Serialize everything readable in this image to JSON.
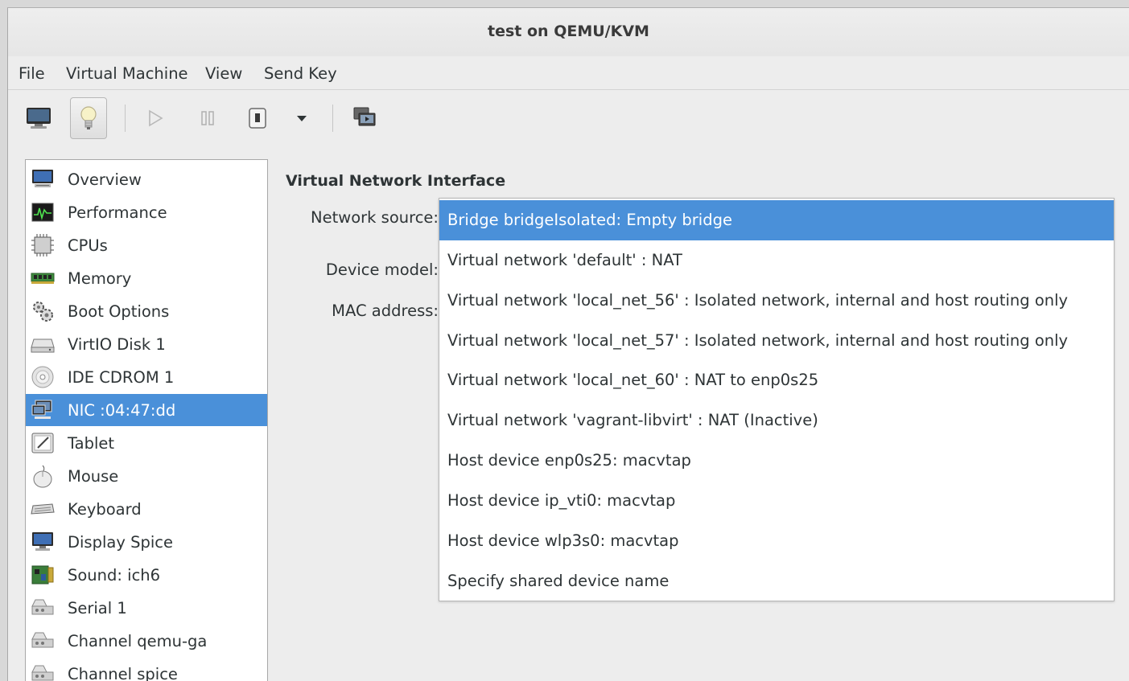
{
  "window": {
    "title": "test on QEMU/KVM"
  },
  "menubar": {
    "items": [
      "File",
      "Virtual Machine",
      "View",
      "Send Key"
    ]
  },
  "toolbar": {
    "buttons": [
      "monitor-icon",
      "lightbulb-icon",
      "play-icon",
      "pause-icon",
      "power-icon",
      "dropdown-arrow-icon",
      "screenshot-icon"
    ],
    "active": "lightbulb-icon"
  },
  "sidebar": {
    "items": [
      {
        "label": "Overview",
        "icon": "monitor-icon"
      },
      {
        "label": "Performance",
        "icon": "performance-graph-icon"
      },
      {
        "label": "CPUs",
        "icon": "cpu-chip-icon"
      },
      {
        "label": "Memory",
        "icon": "memory-module-icon"
      },
      {
        "label": "Boot Options",
        "icon": "gears-icon"
      },
      {
        "label": "VirtIO Disk 1",
        "icon": "hard-disk-icon"
      },
      {
        "label": "IDE CDROM 1",
        "icon": "cdrom-icon"
      },
      {
        "label": "NIC :04:47:dd",
        "icon": "network-card-icon",
        "selected": true
      },
      {
        "label": "Tablet",
        "icon": "tablet-icon"
      },
      {
        "label": "Mouse",
        "icon": "mouse-icon"
      },
      {
        "label": "Keyboard",
        "icon": "keyboard-icon"
      },
      {
        "label": "Display Spice",
        "icon": "display-icon"
      },
      {
        "label": "Sound: ich6",
        "icon": "sound-card-icon"
      },
      {
        "label": "Serial 1",
        "icon": "serial-port-icon"
      },
      {
        "label": "Channel qemu-ga",
        "icon": "channel-icon"
      },
      {
        "label": "Channel spice",
        "icon": "channel-icon"
      }
    ]
  },
  "details": {
    "section_title": "Virtual Network Interface",
    "network_source_label": "Network source:",
    "device_model_label": "Device model:",
    "mac_address_label": "MAC address:"
  },
  "network_source_dropdown": {
    "options": [
      "Bridge bridgeIsolated: Empty bridge",
      "Virtual network 'default' : NAT",
      "Virtual network 'local_net_56' : Isolated network, internal and host routing only",
      "Virtual network 'local_net_57' : Isolated network, internal and host routing only",
      "Virtual network 'local_net_60' : NAT to enp0s25",
      "Virtual network 'vagrant-libvirt' : NAT (Inactive)",
      "Host device enp0s25: macvtap",
      "Host device ip_vti0: macvtap",
      "Host device wlp3s0: macvtap",
      "Specify shared device name"
    ],
    "selected_index": 0
  },
  "colors": {
    "selection": "#4a90d9",
    "window_bg": "#ededed"
  }
}
